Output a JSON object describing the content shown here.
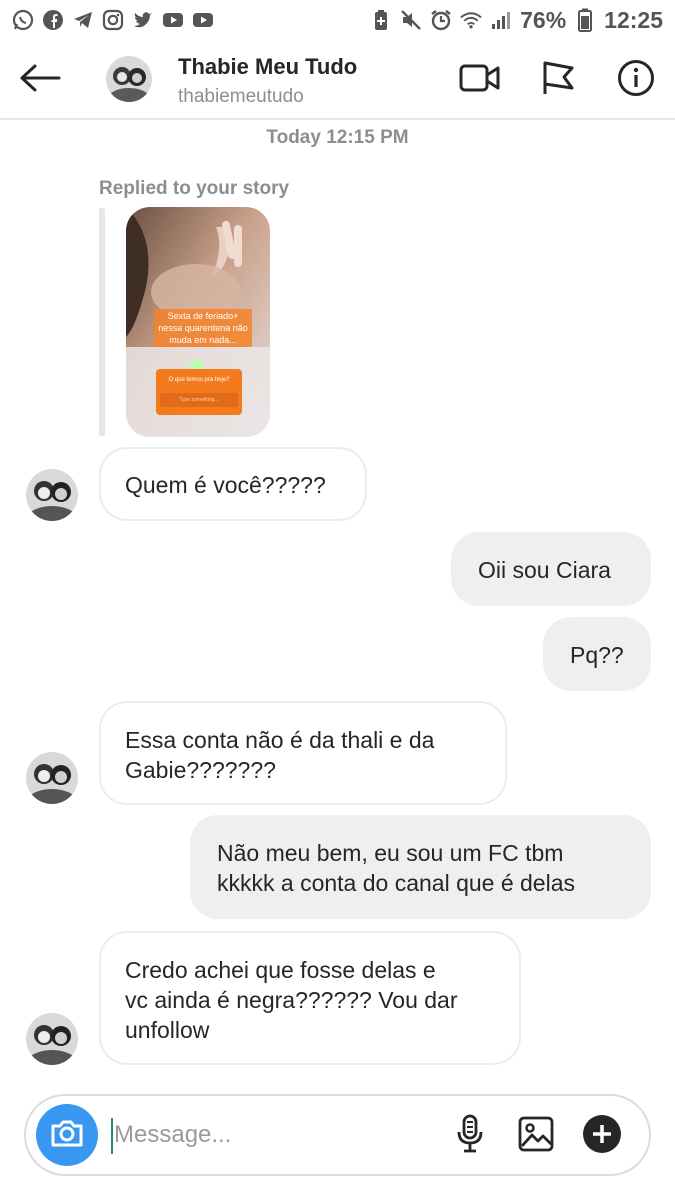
{
  "status_bar": {
    "battery": "76%",
    "time": "12:25",
    "left_icons": [
      "whatsapp-icon",
      "facebook-icon",
      "telegram-icon",
      "instagram-icon",
      "twitter-icon",
      "youtube-icon",
      "youtube-icon"
    ],
    "right_icons": [
      "battery-saver-icon",
      "mute-icon",
      "alarm-icon",
      "wifi-icon",
      "signal-icon",
      "battery-icon"
    ]
  },
  "header": {
    "title": "Thabie Meu Tudo",
    "username": "thabiemeutudo"
  },
  "chat": {
    "timestamp": "Today 12:15 PM",
    "replied_label": "Replied to your story",
    "story": {
      "caption": "Sexta de feriado+ nessa quarentena não muda em nada...",
      "question": "O que temos pra hoje?",
      "question_placeholder": "Type something..."
    },
    "messages": [
      {
        "from": "them",
        "text": "Quem é você?????"
      },
      {
        "from": "me",
        "text": "Oii sou Ciara"
      },
      {
        "from": "me",
        "text": "Pq??"
      },
      {
        "from": "them",
        "text": "Essa conta não é da thali e da\nGabie???????"
      },
      {
        "from": "me",
        "text": "Não meu bem, eu sou um FC tbm\nkkkkk a conta do canal que é delas"
      },
      {
        "from": "them",
        "text": "Credo achei que fosse delas e\nvc ainda é negra?????? Vou dar\nunfollow"
      }
    ]
  },
  "composer": {
    "placeholder": "Message..."
  },
  "colors": {
    "accent": "#3897f0",
    "outgoing_bubble": "#efefef",
    "meta_text": "#8e8e8e"
  }
}
